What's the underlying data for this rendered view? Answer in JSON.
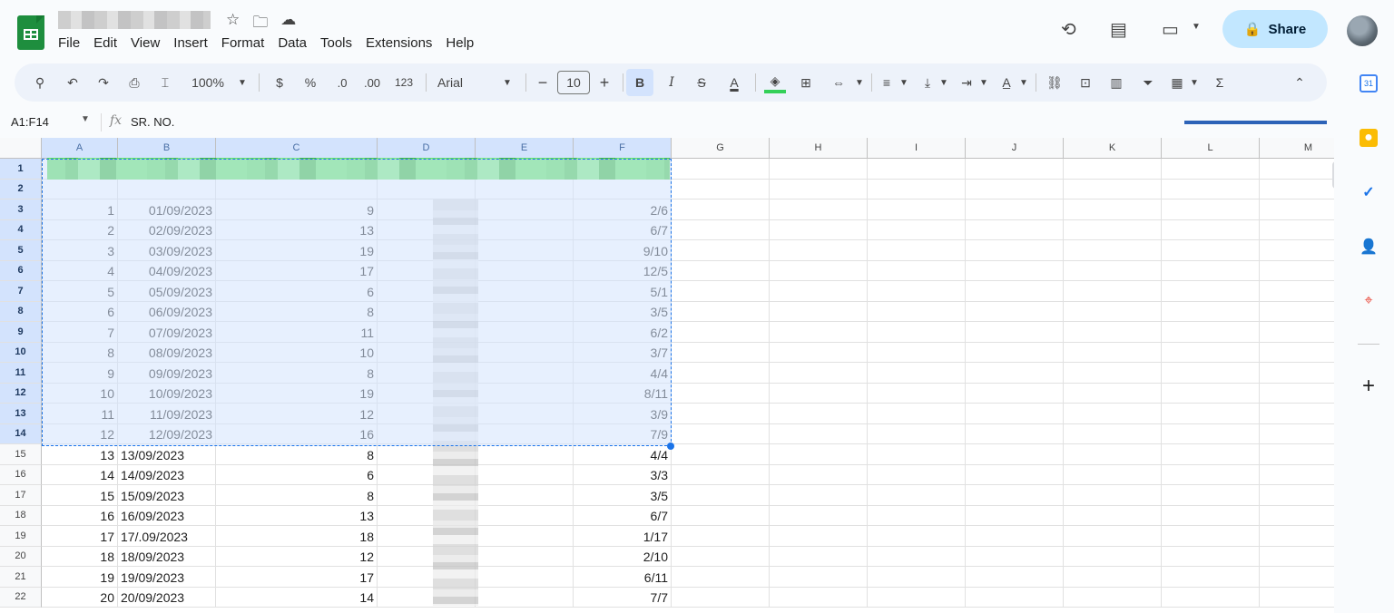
{
  "menu": [
    "File",
    "Edit",
    "View",
    "Insert",
    "Format",
    "Data",
    "Tools",
    "Extensions",
    "Help"
  ],
  "share_label": "Share",
  "toolbar": {
    "zoom": "100%",
    "currency": "$",
    "percent": "%",
    "dec_decrease": ".0",
    "dec_increase": ".00",
    "number_format": "123",
    "font": "Arial",
    "font_size": "10",
    "bold": "B",
    "italic": "I",
    "text_color": "A",
    "sum": "Σ"
  },
  "formula_bar": {
    "name_box": "A1:F14",
    "fx": "fx",
    "value": "SR. NO."
  },
  "columns": [
    "A",
    "B",
    "C",
    "D",
    "E",
    "F",
    "G",
    "H",
    "I",
    "J",
    "K",
    "L",
    "M"
  ],
  "rows": [
    {
      "n": "1",
      "a": "",
      "b": "",
      "c": "",
      "f": ""
    },
    {
      "n": "2",
      "a": "",
      "b": "",
      "c": "",
      "f": ""
    },
    {
      "n": "3",
      "a": "1",
      "b": "01/09/2023",
      "c": "9",
      "f": "2/6"
    },
    {
      "n": "4",
      "a": "2",
      "b": "02/09/2023",
      "c": "13",
      "f": "6/7"
    },
    {
      "n": "5",
      "a": "3",
      "b": "03/09/2023",
      "c": "19",
      "f": "9/10"
    },
    {
      "n": "6",
      "a": "4",
      "b": "04/09/2023",
      "c": "17",
      "f": "12/5"
    },
    {
      "n": "7",
      "a": "5",
      "b": "05/09/2023",
      "c": "6",
      "f": "5/1"
    },
    {
      "n": "8",
      "a": "6",
      "b": "06/09/2023",
      "c": "8",
      "f": "3/5"
    },
    {
      "n": "9",
      "a": "7",
      "b": "07/09/2023",
      "c": "11",
      "f": "6/2"
    },
    {
      "n": "10",
      "a": "8",
      "b": "08/09/2023",
      "c": "10",
      "f": "3/7"
    },
    {
      "n": "11",
      "a": "9",
      "b": "09/09/2023",
      "c": "8",
      "f": "4/4"
    },
    {
      "n": "12",
      "a": "10",
      "b": "10/09/2023",
      "c": "19",
      "f": "8/11"
    },
    {
      "n": "13",
      "a": "11",
      "b": "11/09/2023",
      "c": "12",
      "f": "3/9"
    },
    {
      "n": "14",
      "a": "12",
      "b": "12/09/2023",
      "c": "16",
      "f": "7/9"
    },
    {
      "n": "15",
      "a": "13",
      "b": "13/09/2023",
      "c": "8",
      "f": "4/4"
    },
    {
      "n": "16",
      "a": "14",
      "b": "14/09/2023",
      "c": "6",
      "f": "3/3"
    },
    {
      "n": "17",
      "a": "15",
      "b": "15/09/2023",
      "c": "8",
      "f": "3/5"
    },
    {
      "n": "18",
      "a": "16",
      "b": "16/09/2023",
      "c": "13",
      "f": "6/7"
    },
    {
      "n": "19",
      "a": "17",
      "b": "17/.09/2023",
      "c": "18",
      "f": "1/17"
    },
    {
      "n": "20",
      "a": "18",
      "b": "18/09/2023",
      "c": "12",
      "f": "2/10"
    },
    {
      "n": "21",
      "a": "19",
      "b": "19/09/2023",
      "c": "17",
      "f": "6/11"
    },
    {
      "n": "22",
      "a": "20",
      "b": "20/09/2023",
      "c": "14",
      "f": "7/7"
    }
  ],
  "side_panel": {
    "calendar_label": "31",
    "add": "+"
  }
}
